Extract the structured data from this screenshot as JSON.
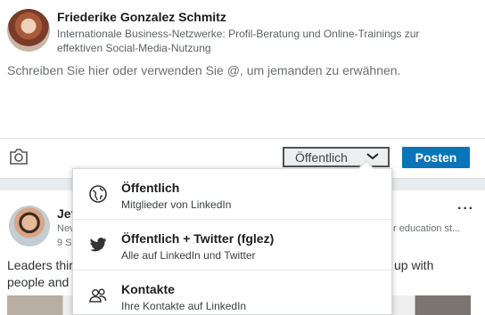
{
  "composer": {
    "author_name": "Friederike Gonzalez Schmitz",
    "author_headline": "Internationale Business-Netzwerke: Profil-Beratung und Online-Trainings zur effektiven Social-Media-Nutzung",
    "placeholder": "Schreiben Sie hier oder verwenden Sie @, um jemanden zu erwähnen."
  },
  "toolbar": {
    "camera_icon": "camera-icon",
    "visibility_label": "Öffentlich",
    "post_label": "Posten"
  },
  "dropdown": {
    "options": [
      {
        "title": "Öffentlich",
        "subtitle": "Mitglieder von LinkedIn",
        "icon": "globe-icon"
      },
      {
        "title": "Öffentlich + Twitter (fglez)",
        "subtitle": "Alle auf LinkedIn und Twitter",
        "icon": "twitter-icon"
      },
      {
        "title": "Kontakte",
        "subtitle": "Ihre Kontakte auf LinkedIn",
        "icon": "contacts-icon"
      }
    ]
  },
  "feed_post": {
    "author_name_partial": "Jef",
    "headline_partial_left": "Nev",
    "headline_partial_right": "r education st...",
    "time_partial": "9 S",
    "more_label": "···",
    "text_line1_left": "Leaders thir",
    "text_line1_right": "up with",
    "text_line2_left": "people and"
  }
}
